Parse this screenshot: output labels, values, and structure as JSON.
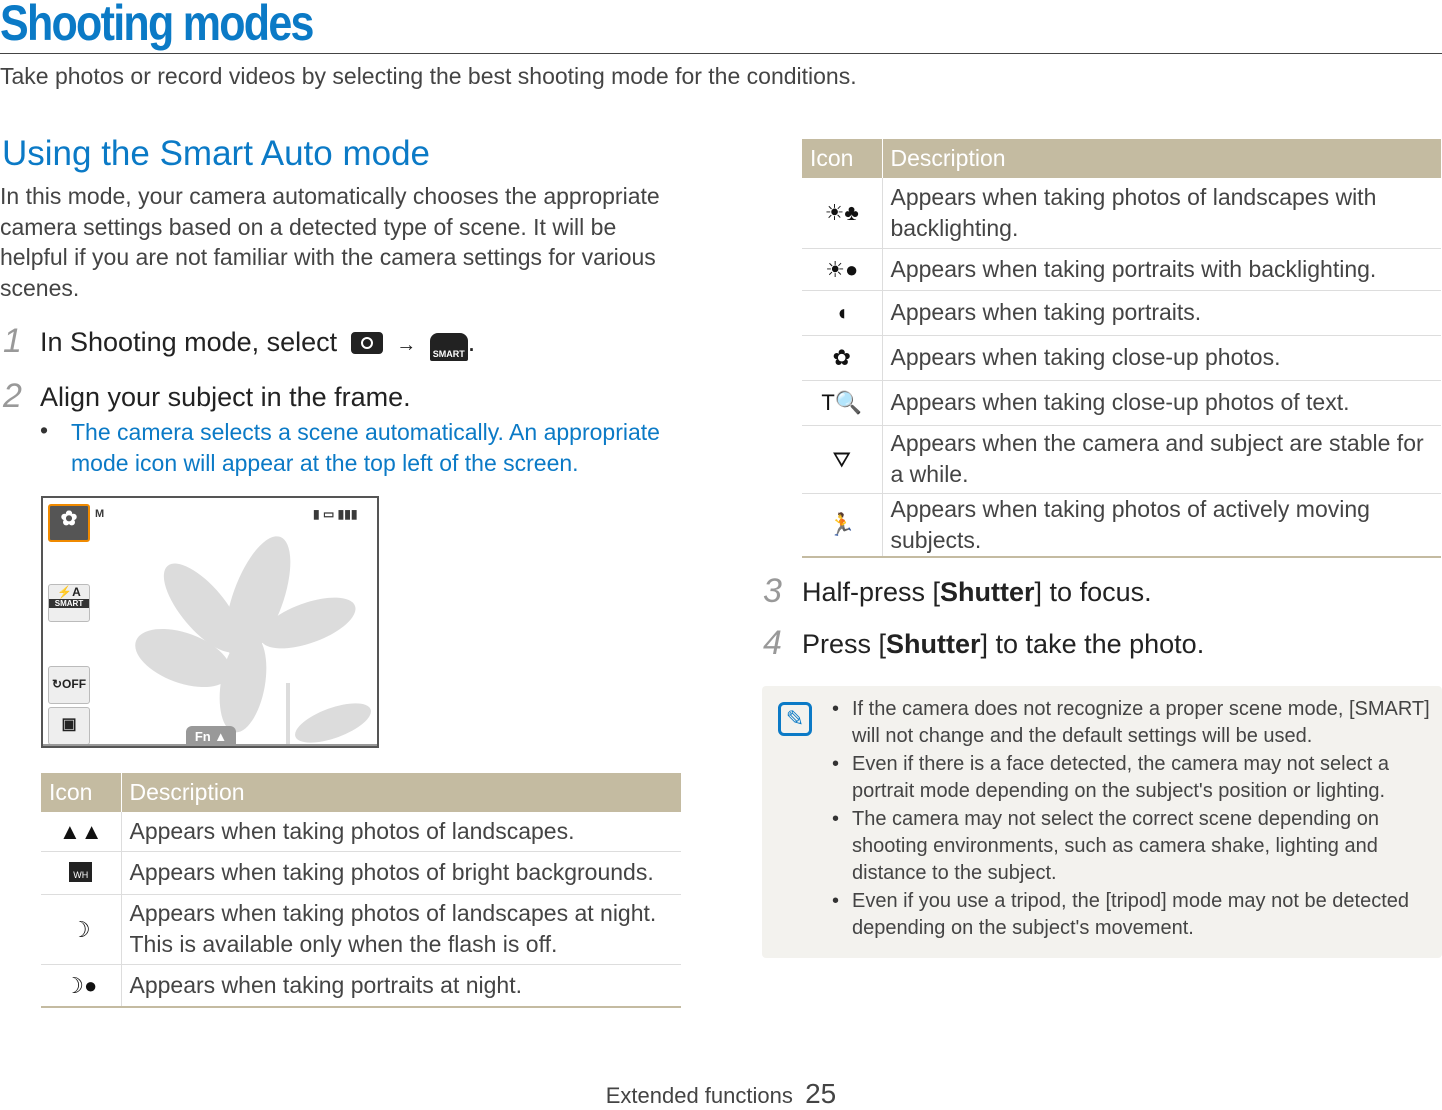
{
  "page": {
    "title": "Shooting modes",
    "subtitle": "Take photos or record videos by selecting the best shooting mode for the conditions.",
    "footer_section": "Extended functions",
    "page_number": "25"
  },
  "section": {
    "heading": "Using the Smart Auto mode",
    "intro": "In this mode, your camera automatically chooses the appropriate camera settings based on a detected type of scene. It will be helpful if you are not familiar with the camera settings for various scenes."
  },
  "steps": [
    {
      "num": "1",
      "text": "In Shooting mode, select",
      "icons": [
        "camera-icon",
        "smart-auto-icon"
      ],
      "arrow": "→"
    },
    {
      "num": "2",
      "text": "Align your subject in the frame.",
      "bullet": "The camera selects a scene automatically. An appropriate mode icon will appear at the top left of the screen."
    },
    {
      "num": "3",
      "pre": "Half-press [",
      "key": "Shutter",
      "post": "] to focus."
    },
    {
      "num": "4",
      "pre": "Press [",
      "key": "Shutter",
      "post": "] to take the photo."
    }
  ],
  "screen": {
    "flash_label": "A",
    "smart_label": "SMART",
    "timer_label": "OFF",
    "fn_label": "Fn ▲",
    "size_label": "M"
  },
  "table_left": {
    "headers": [
      "Icon",
      "Description"
    ],
    "rows": [
      {
        "icon": "landscape-icon",
        "glyph": "▲▲",
        "desc": "Appears when taking photos of landscapes."
      },
      {
        "icon": "white-background-icon",
        "glyph": "WH",
        "desc": "Appears when taking photos of bright backgrounds."
      },
      {
        "icon": "night-landscape-icon",
        "glyph": "☽",
        "desc": "Appears when taking photos of landscapes at night. This is available only when the flash is off."
      },
      {
        "icon": "night-portrait-icon",
        "glyph": "☽●",
        "desc": "Appears when taking portraits at night."
      }
    ]
  },
  "table_right": {
    "headers": [
      "Icon",
      "Description"
    ],
    "rows": [
      {
        "icon": "backlight-landscape-icon",
        "glyph": "☀♣",
        "desc": "Appears when taking photos of landscapes with backlighting."
      },
      {
        "icon": "backlight-portrait-icon",
        "glyph": "☀●",
        "desc": "Appears when taking portraits with backlighting."
      },
      {
        "icon": "portrait-icon",
        "glyph": "◖",
        "desc": "Appears when taking portraits."
      },
      {
        "icon": "macro-icon",
        "glyph": "✿",
        "desc": "Appears when taking close-up photos."
      },
      {
        "icon": "macro-text-icon",
        "glyph": "T🔍",
        "desc": "Appears when taking close-up photos of text."
      },
      {
        "icon": "tripod-icon",
        "glyph": "⛛",
        "desc": "Appears when the camera and subject are stable for a while."
      },
      {
        "icon": "action-icon",
        "glyph": "🏃",
        "desc": "Appears when taking photos of actively moving subjects."
      }
    ]
  },
  "note": {
    "icon": "note-pencil-icon",
    "items": [
      "If the camera does not recognize a proper scene mode, [SMART] will not change and the default settings will be used.",
      "Even if there is a face detected, the camera may not select a portrait mode depending on the subject's position or lighting.",
      "The camera may not select the correct scene depending on shooting environments, such as camera shake, lighting and distance to the subject.",
      "Even if you use a tripod, the [tripod] mode may not be detected depending on the subject's movement."
    ]
  },
  "colors": {
    "accent": "#0b7ac6",
    "table_header": "#c4bba1",
    "note_bg": "#f3f2ee",
    "highlight": "#f08a00"
  }
}
